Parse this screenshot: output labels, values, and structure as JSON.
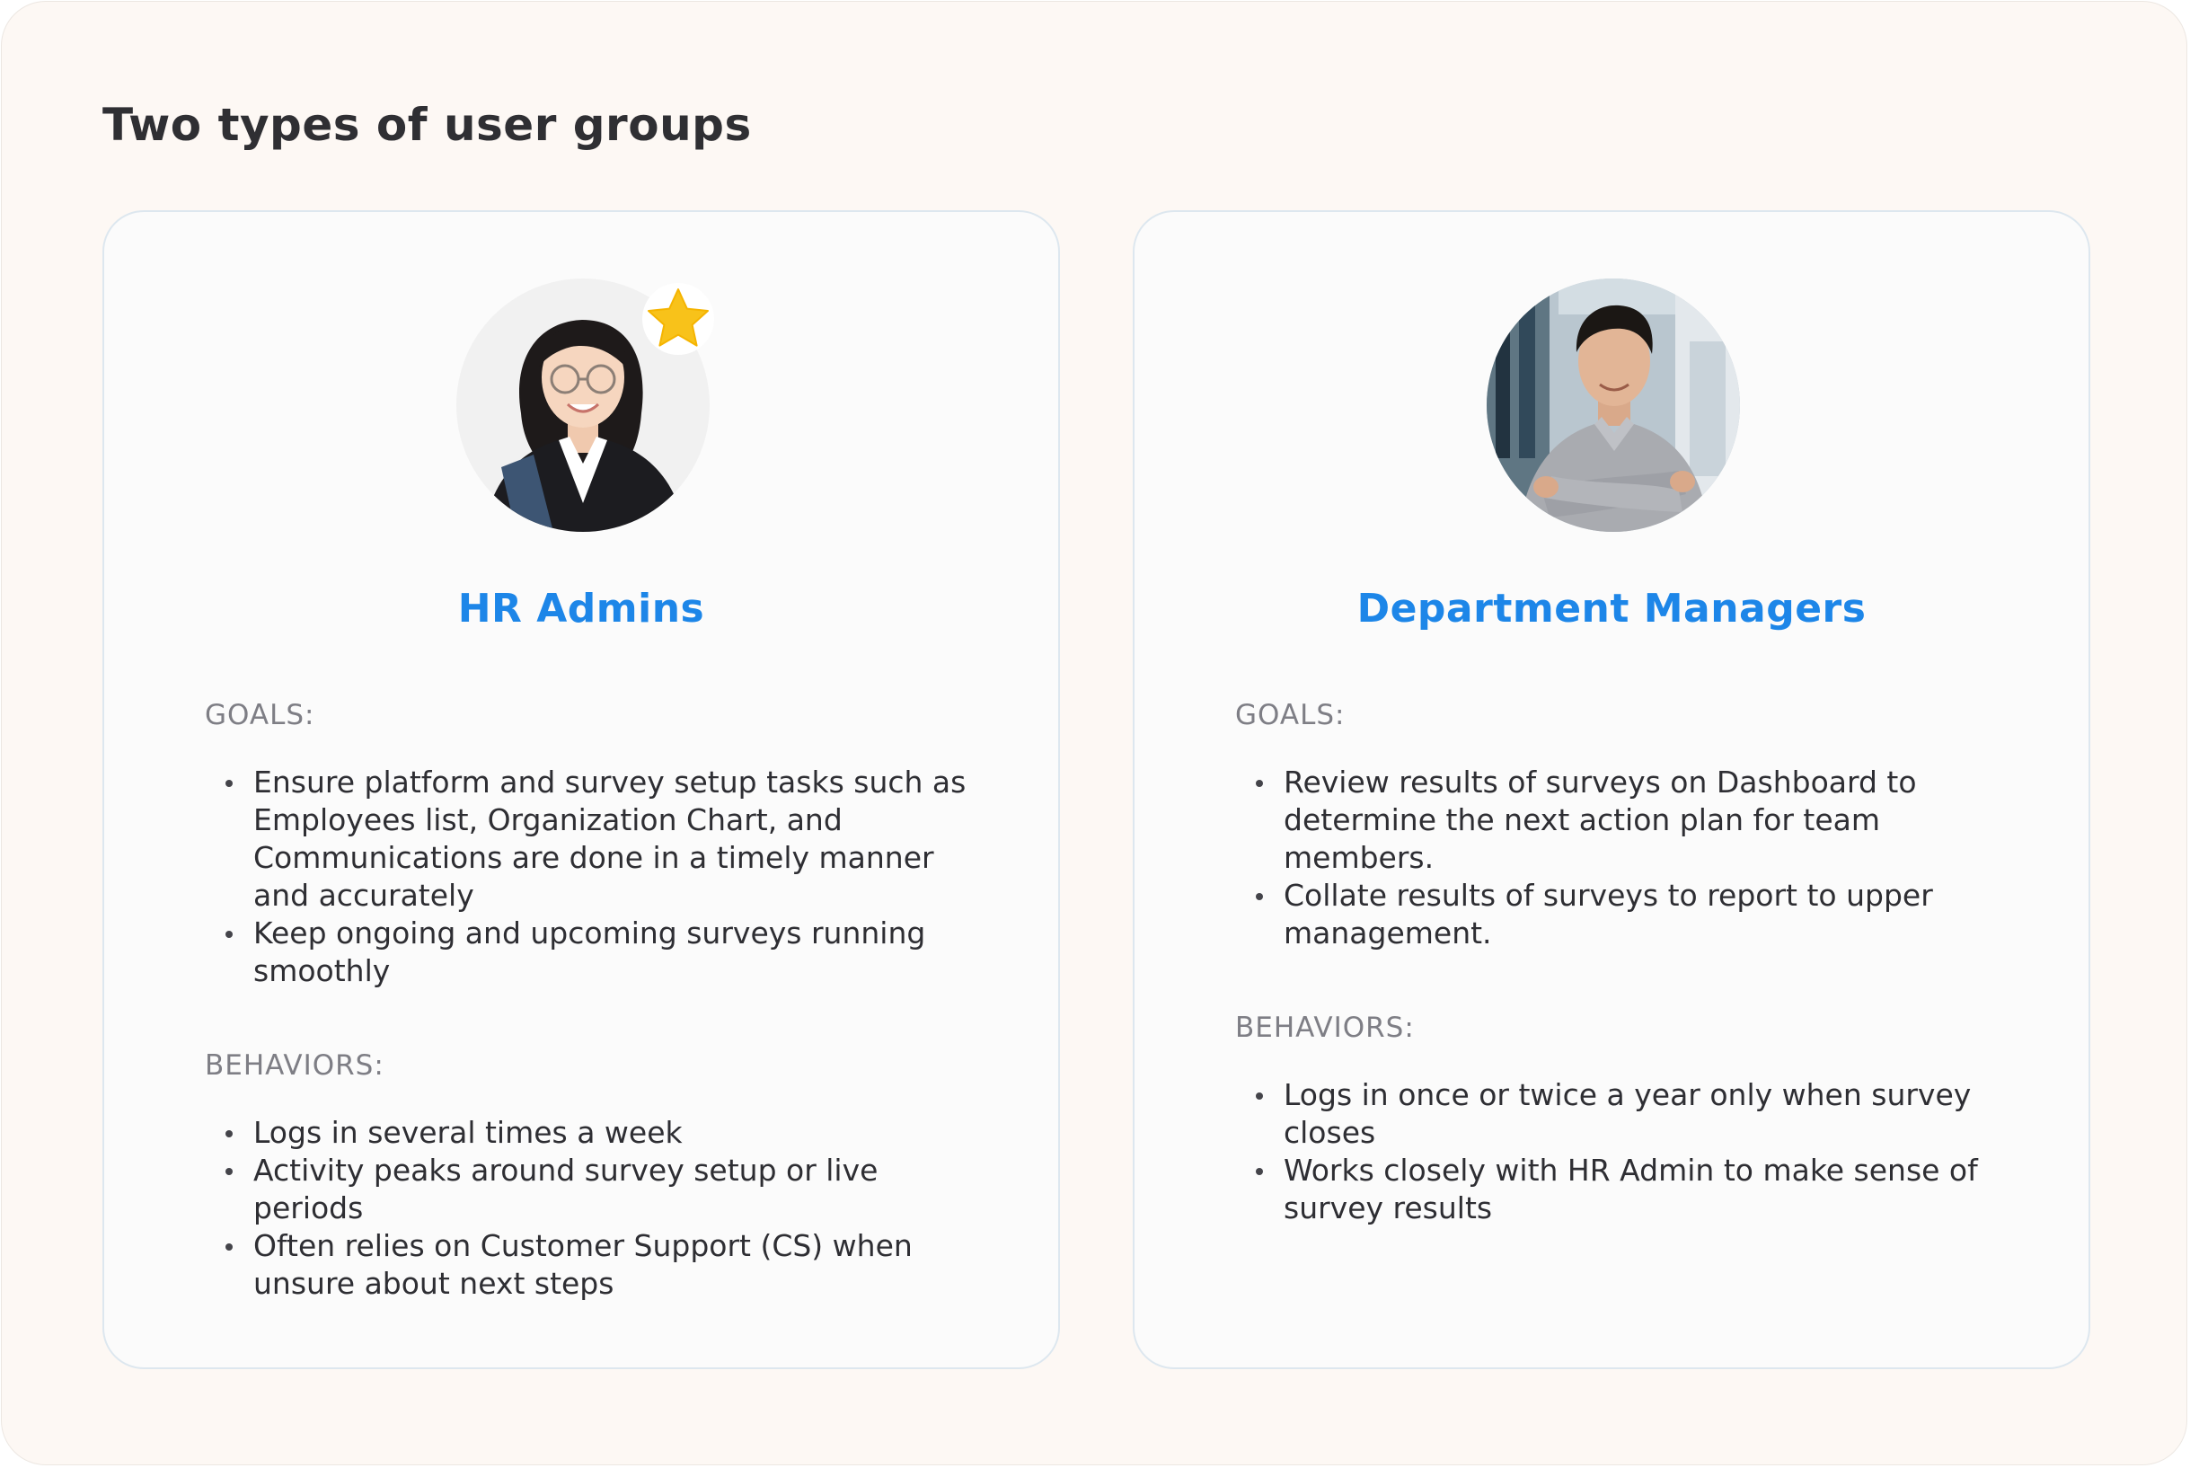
{
  "page": {
    "title": "Two types of user groups"
  },
  "colors": {
    "page_background": "#fdf8f4",
    "card_background": "#fbfbfb",
    "card_border": "#dde7ef",
    "accent_blue": "#1d86e8",
    "label_gray": "#7e7e85",
    "star_yellow": "#f8c21a"
  },
  "groups": [
    {
      "name": "HR Admins",
      "avatar_icon": "person-photo-woman",
      "badge_icon": "star-icon",
      "goals_label": "GOALS:",
      "goals": [
        "Ensure platform and survey setup tasks such as Employees list, Organization Chart, and Communications are done in a timely manner and accurately",
        "Keep ongoing and upcoming surveys running smoothly"
      ],
      "behaviors_label": "BEHAVIORS:",
      "behaviors": [
        "Logs in several times a week",
        "Activity peaks around survey setup or live periods",
        "Often relies on Customer Support (CS) when unsure about next steps"
      ]
    },
    {
      "name": "Department Managers",
      "avatar_icon": "person-photo-man",
      "goals_label": "GOALS:",
      "goals": [
        "Review results of surveys on Dashboard to determine the next action plan for team members.",
        "Collate results of surveys to report to upper management."
      ],
      "behaviors_label": "BEHAVIORS:",
      "behaviors": [
        "Logs in once or twice a year only when survey closes",
        "Works closely with HR Admin to make sense of survey results"
      ]
    }
  ]
}
